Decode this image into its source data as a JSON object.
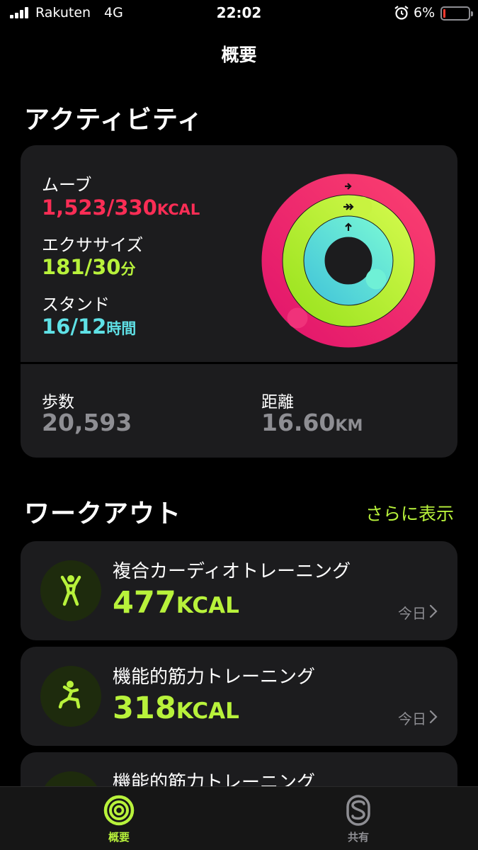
{
  "status_bar": {
    "carrier": "Rakuten",
    "network": "4G",
    "time": "22:02",
    "battery": "6%"
  },
  "nav": {
    "title": "概要"
  },
  "activity": {
    "section_title": "アクティビティ",
    "move": {
      "label": "ムーブ",
      "value": "1,523/330",
      "unit": "KCAL",
      "color": "#fa2d55"
    },
    "exercise": {
      "label": "エクササイズ",
      "value": "181/30",
      "unit": "分",
      "color": "#b8f23b"
    },
    "stand": {
      "label": "スタンド",
      "value": "16/12",
      "unit": "時間",
      "color": "#5fe1e6"
    },
    "steps": {
      "label": "歩数",
      "value": "20,593"
    },
    "distance": {
      "label": "距離",
      "value": "16.60",
      "unit": "KM"
    }
  },
  "workouts": {
    "section_title": "ワークアウト",
    "see_more": "さらに表示",
    "items": [
      {
        "name": "複合カーディオトレーニング",
        "value": "477",
        "unit": "KCAL",
        "date": "今日",
        "icon": "cardio-figure-icon"
      },
      {
        "name": "機能的筋力トレーニング",
        "value": "318",
        "unit": "KCAL",
        "date": "今日",
        "icon": "strength-figure-icon"
      },
      {
        "name": "機能的筋力トレーニング",
        "icon": "strength-figure-icon"
      }
    ]
  },
  "tab_bar": {
    "tabs": [
      {
        "label": "概要",
        "icon": "activity-rings-icon",
        "active": true
      },
      {
        "label": "共有",
        "icon": "sharing-icon",
        "active": false
      }
    ]
  }
}
